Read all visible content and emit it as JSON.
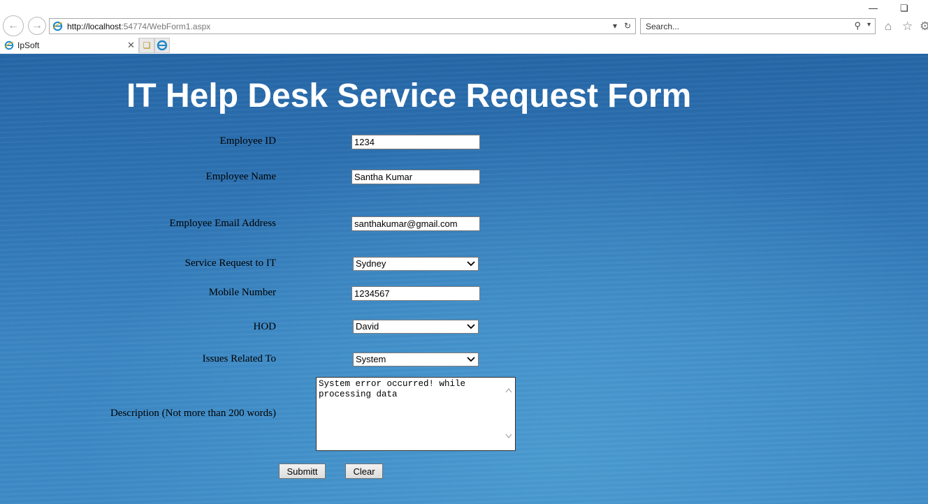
{
  "browser": {
    "address_host": "http://localhost",
    "address_rest": ":54774/WebForm1.aspx",
    "search_placeholder": "Search...",
    "tab_title": "IpSoft",
    "icons": [
      "back-icon",
      "forward-icon",
      "ie-logo-icon",
      "dropdown-icon",
      "refresh-icon",
      "search-icon",
      "home-icon",
      "favorites-star-icon",
      "settings-gear-icon",
      "minimize-icon",
      "restore-icon",
      "close-tab-icon",
      "new-tab-icon"
    ]
  },
  "form": {
    "heading": "IT Help Desk Service Request Form",
    "fields": {
      "employee_id": {
        "label": "Employee ID",
        "value": "1234"
      },
      "employee_name": {
        "label": "Employee Name",
        "value": "Santha Kumar"
      },
      "email": {
        "label": "Employee Email Address",
        "value": "santhakumar@gmail.com"
      },
      "service_request": {
        "label": "Service Request to IT",
        "value": "Sydney"
      },
      "mobile": {
        "label": "Mobile Number",
        "value": "1234567"
      },
      "hod": {
        "label": "HOD",
        "value": "David"
      },
      "issues": {
        "label": "Issues Related To",
        "value": "System"
      },
      "description": {
        "label": "Description (Not more than 200 words)",
        "value": "System error occurred! while processing data"
      }
    },
    "submit_label": "Submitt",
    "clear_label": "Clear"
  },
  "colors": {
    "page_bg_top": "#2566a6",
    "page_bg_bottom": "#3d8ac6",
    "heading": "#ffffff"
  }
}
